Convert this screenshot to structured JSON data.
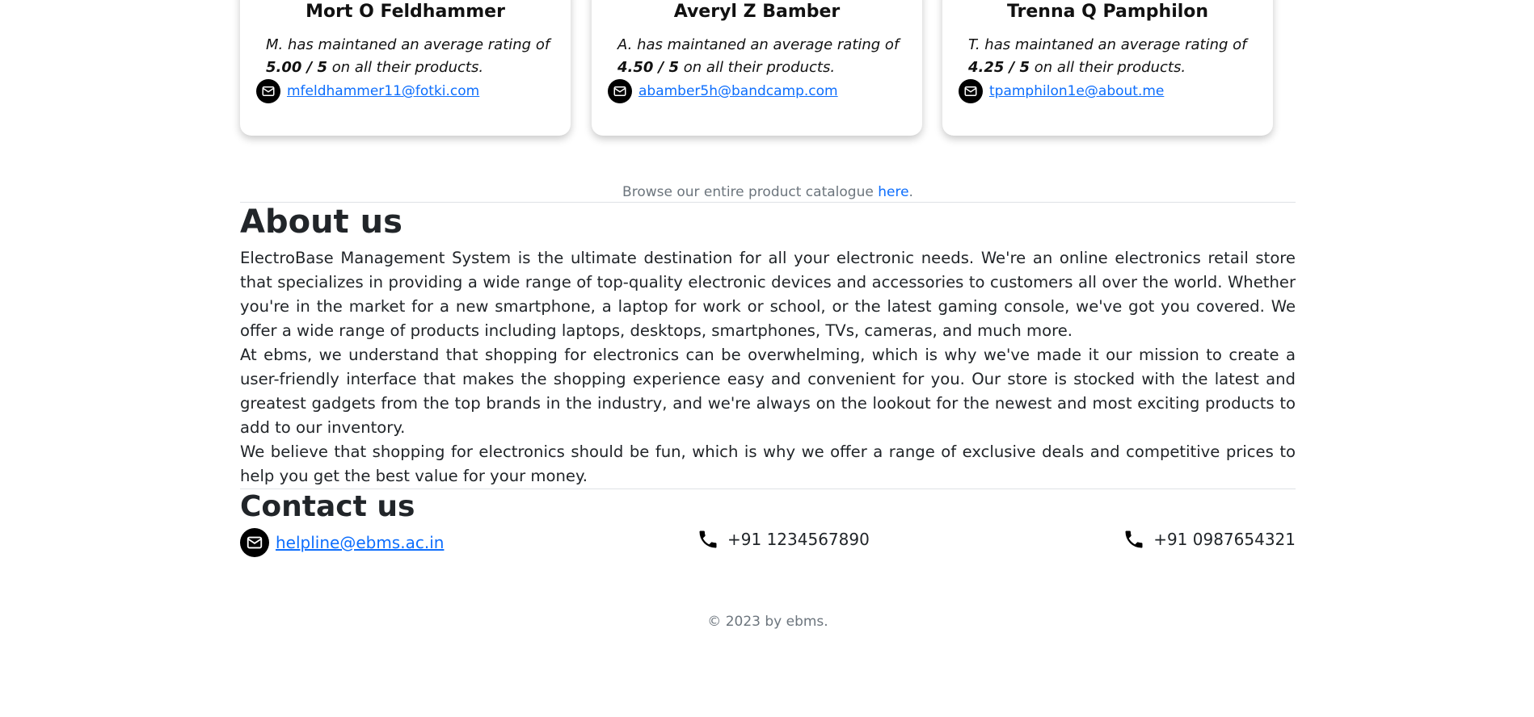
{
  "sellers": [
    {
      "name": "Mort O Feldhammer",
      "initial_prefix": "M. has maintaned an average rating of",
      "rating": "5.00 / 5",
      "rating_suffix": " on all their products.",
      "email": "mfeldhammer11@fotki.com"
    },
    {
      "name": "Averyl Z Bamber",
      "initial_prefix": "A. has maintaned an average rating of",
      "rating": "4.50 / 5",
      "rating_suffix": " on all their products.",
      "email": "abamber5h@bandcamp.com"
    },
    {
      "name": "Trenna Q Pamphilon",
      "initial_prefix": "T. has maintaned an average rating of",
      "rating": "4.25 / 5",
      "rating_suffix": " on all their products.",
      "email": "tpamphilon1e@about.me"
    }
  ],
  "browse": {
    "text": "Browse our entire product catalogue ",
    "link": "here",
    "after": "."
  },
  "about": {
    "title": "About us",
    "paragraphs": [
      "ElectroBase Management System is the ultimate destination for all your electronic needs. We're an online electronics retail store that specializes in providing a wide range of top-quality electronic devices and accessories to customers all over the world. Whether you're in the market for a new smartphone, a laptop for work or school, or the latest gaming console, we've got you covered. We offer a wide range of products including laptops, desktops, smartphones, TVs, cameras, and much more.",
      "At ebms, we understand that shopping for electronics can be overwhelming, which is why we've made it our mission to create a user-friendly interface that makes the shopping experience easy and convenient for you. Our store is stocked with the latest and greatest gadgets from the top brands in the industry, and we're always on the lookout for the newest and most exciting products to add to our inventory.",
      "We believe that shopping for electronics should be fun, which is why we offer a range of exclusive deals and competitive prices to help you get the best value for your money."
    ]
  },
  "contact": {
    "title": "Contact us",
    "email": "helpline@ebms.ac.in",
    "phone1": "+91 1234567890",
    "phone2": "+91 0987654321"
  },
  "footer": {
    "text": "© 2023 by ebms."
  },
  "icons": {
    "mail": "envelope-icon",
    "phone": "phone-icon"
  }
}
